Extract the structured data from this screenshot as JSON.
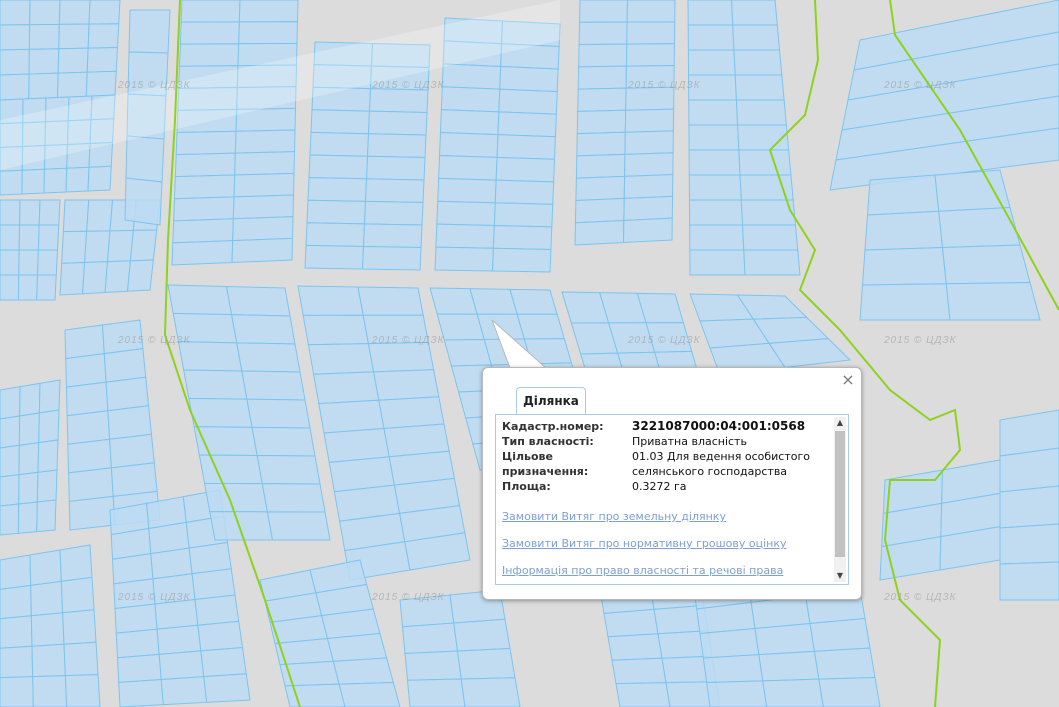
{
  "map": {
    "watermark_text": "2015 © ЦДЗК",
    "colors": {
      "background": "#dcdcdc",
      "parcel_fill": "#bcdcf3",
      "parcel_stroke": "#7cc4ef",
      "boundary_line": "#8dd21f"
    }
  },
  "popup": {
    "tab_label": "Ділянка",
    "close_label": "×",
    "fields": [
      {
        "label": "Кадастр.номер:",
        "value": "3221087000:04:001:0568"
      },
      {
        "label": "Тип власності:",
        "value": "Приватна власність"
      },
      {
        "label": "Цільове призначення:",
        "value": "01.03 Для ведення особистого селянського господарства"
      },
      {
        "label": "Площа:",
        "value": "0.3272 га"
      }
    ],
    "links": [
      "Замовити Витяг про земельну ділянку",
      "Замовити Витяг про нормативну грошову оцінку",
      "Інформація про право власності та речові права"
    ],
    "scroll_up_icon": "▲",
    "scroll_down_icon": "▼"
  }
}
